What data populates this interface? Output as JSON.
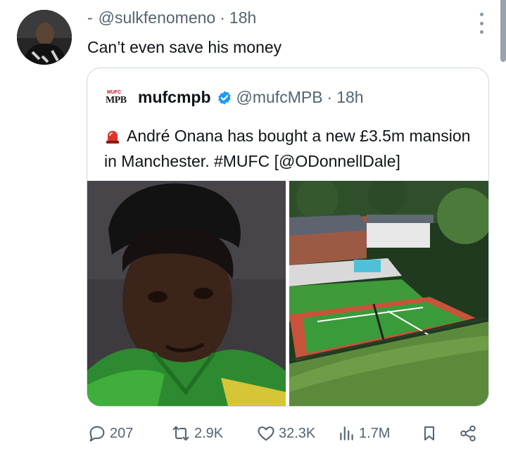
{
  "tweet": {
    "dash": "-",
    "handle": "@sulkfenomeno",
    "separator": "·",
    "time": "18h",
    "text": "Can’t even save his money"
  },
  "quote": {
    "logo_top": "MUFC",
    "logo_bottom": "MPB",
    "name": "mufcmpb",
    "handle": "@mufcMPB",
    "separator": "·",
    "time": "18h",
    "text": "André Onana has bought a new £3.5m mansion in Manchester. #MUFC [@ODonnellDale]"
  },
  "actions": {
    "replies": "207",
    "reposts": "2.9K",
    "likes": "32.3K",
    "views": "1.7M"
  },
  "colors": {
    "text": "#0f1419",
    "muted": "#536471",
    "verified": "#1d9bf0",
    "border": "#cfd9de"
  },
  "icons": [
    "more-icon",
    "verified-badge-icon",
    "siren-icon",
    "reply-icon",
    "repost-icon",
    "like-icon",
    "views-icon",
    "bookmark-icon",
    "share-icon"
  ]
}
